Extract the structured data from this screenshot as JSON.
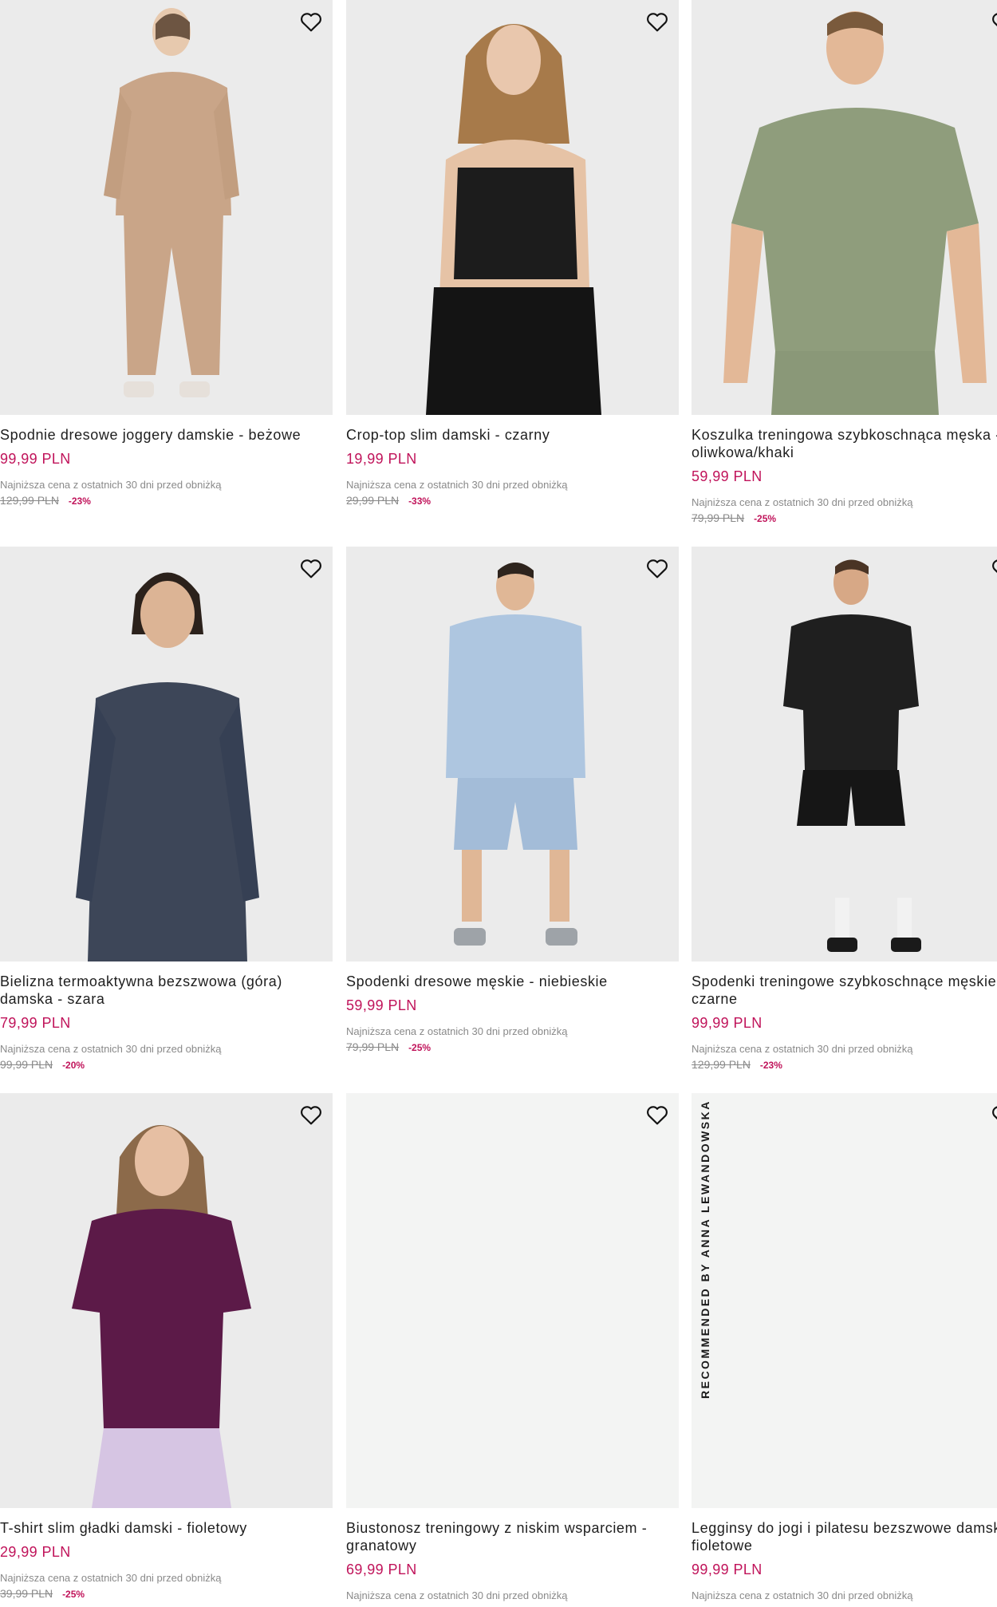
{
  "products": [
    {
      "title": "Spodnie dresowe joggery damskie - beżowe",
      "price": "99,99 PLN",
      "lowest_label": "Najniższa cena z ostatnich 30 dni przed obniżką",
      "old_price": "129,99 PLN",
      "discount": "-23%"
    },
    {
      "title": "Crop-top slim damski - czarny",
      "price": "19,99 PLN",
      "lowest_label": "Najniższa cena z ostatnich 30 dni przed obniżką",
      "old_price": "29,99 PLN",
      "discount": "-33%"
    },
    {
      "title": "Koszulka treningowa szybkoschnąca męska - oliwkowa/khaki",
      "price": "59,99 PLN",
      "lowest_label": "Najniższa cena z ostatnich 30 dni przed obniżką",
      "old_price": "79,99 PLN",
      "discount": "-25%"
    },
    {
      "title": "Bielizna termoaktywna bezszwowa (góra) damska - szara",
      "price": "79,99 PLN",
      "lowest_label": "Najniższa cena z ostatnich 30 dni przed obniżką",
      "old_price": "99,99 PLN",
      "discount": "-20%"
    },
    {
      "title": "Spodenki dresowe męskie - niebieskie",
      "price": "59,99 PLN",
      "lowest_label": "Najniższa cena z ostatnich 30 dni przed obniżką",
      "old_price": "79,99 PLN",
      "discount": "-25%"
    },
    {
      "title": "Spodenki treningowe szybkoschnące męskie - czarne",
      "price": "99,99 PLN",
      "lowest_label": "Najniższa cena z ostatnich 30 dni przed obniżką",
      "old_price": "129,99 PLN",
      "discount": "-23%"
    },
    {
      "title": "T-shirt slim gładki damski - fioletowy",
      "price": "29,99 PLN",
      "lowest_label": "Najniższa cena z ostatnich 30 dni przed obniżką",
      "old_price": "39,99 PLN",
      "discount": "-25%"
    },
    {
      "title": "Biustonosz treningowy z niskim wsparciem - granatowy",
      "price": "69,99 PLN",
      "lowest_label": "Najniższa cena z ostatnich 30 dni przed obniżką",
      "old_price": "",
      "discount": ""
    },
    {
      "title": "Legginsy do jogi i pilatesu bezszwowe damskie - fioletowe",
      "price": "99,99 PLN",
      "lowest_label": "Najniższa cena z ostatnich 30 dni przed obniżką",
      "old_price": "",
      "discount": ""
    }
  ],
  "badge_recommended": "RECOMMENDED BY ANNA LEWANDOWSKA",
  "icons": {
    "favorite": "heart-outline-icon"
  },
  "colors": {
    "price": "#c0135a",
    "muted": "#8a8a8a",
    "image_bg": "#ebebeb"
  }
}
